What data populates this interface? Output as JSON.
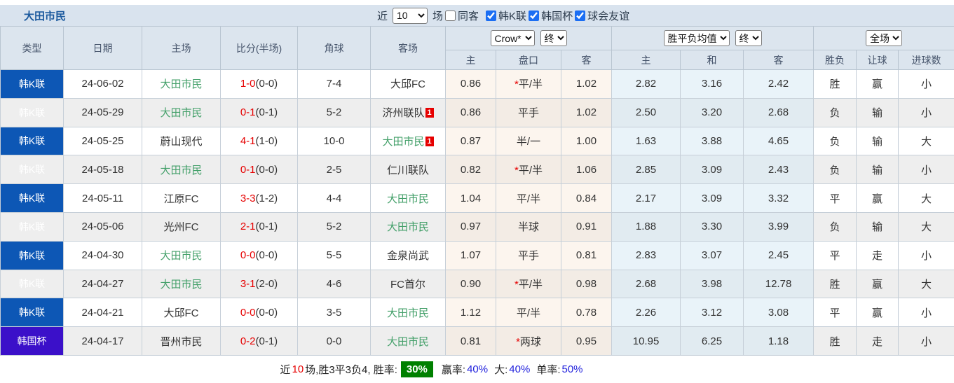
{
  "titlebar": {
    "title": "大田市民",
    "filters": {
      "recent_label": "近",
      "count_value": "10",
      "games_label": "场",
      "same_opponent": {
        "label": "同客",
        "checked": false
      },
      "leagues": [
        {
          "label": "韩K联",
          "checked": true
        },
        {
          "label": "韩国杯",
          "checked": true
        },
        {
          "label": "球会友谊",
          "checked": true
        }
      ]
    }
  },
  "table": {
    "header": {
      "main_columns": [
        "类型",
        "日期",
        "主场",
        "比分(半场)",
        "角球",
        "客场"
      ],
      "odds_group": {
        "company": "Crow*",
        "time": "终"
      },
      "avg_group": {
        "name": "胜平负均值",
        "time": "终"
      },
      "scope_group": {
        "scope": "全场"
      },
      "sub_columns": [
        "主",
        "盘口",
        "客",
        "主",
        "和",
        "客",
        "胜负",
        "让球",
        "进球数"
      ]
    },
    "rows": [
      {
        "type": "韩K联",
        "type_style": "league",
        "date": "24-06-02",
        "home": "大田市民",
        "home_self": true,
        "home_card": "",
        "score_ft": "1-0",
        "score_ht": "(0-0)",
        "corner": "7-4",
        "away": "大邱FC",
        "away_self": false,
        "away_card": "",
        "odds": {
          "home": "0.86",
          "handicap": "平/半",
          "star": true,
          "away": "1.02"
        },
        "avg": {
          "home": "2.82",
          "draw": "3.16",
          "away": "2.42"
        },
        "result": {
          "text": "胜",
          "color": "red"
        },
        "handicap_result": {
          "text": "赢",
          "color": "pink"
        },
        "goals": {
          "text": "小",
          "color": "green"
        }
      },
      {
        "type": "韩K联",
        "type_style": "league",
        "date": "24-05-29",
        "home": "大田市民",
        "home_self": true,
        "home_card": "",
        "score_ft": "0-1",
        "score_ht": "(0-1)",
        "corner": "5-2",
        "away": "济州联队",
        "away_self": false,
        "away_card": "1",
        "odds": {
          "home": "0.86",
          "handicap": "平手",
          "star": false,
          "away": "1.02"
        },
        "avg": {
          "home": "2.50",
          "draw": "3.20",
          "away": "2.68"
        },
        "result": {
          "text": "负",
          "color": "green"
        },
        "handicap_result": {
          "text": "输",
          "color": "green"
        },
        "goals": {
          "text": "小",
          "color": "green"
        }
      },
      {
        "type": "韩K联",
        "type_style": "league",
        "date": "24-05-25",
        "home": "蔚山现代",
        "home_self": false,
        "home_card": "",
        "score_ft": "4-1",
        "score_ht": "(1-0)",
        "corner": "10-0",
        "away": "大田市民",
        "away_self": true,
        "away_card": "1",
        "odds": {
          "home": "0.87",
          "handicap": "半/一",
          "star": false,
          "away": "1.00"
        },
        "avg": {
          "home": "1.63",
          "draw": "3.88",
          "away": "4.65"
        },
        "result": {
          "text": "负",
          "color": "green"
        },
        "handicap_result": {
          "text": "输",
          "color": "green"
        },
        "goals": {
          "text": "大",
          "color": "red"
        }
      },
      {
        "type": "韩K联",
        "type_style": "league",
        "date": "24-05-18",
        "home": "大田市民",
        "home_self": true,
        "home_card": "",
        "score_ft": "0-1",
        "score_ht": "(0-0)",
        "corner": "2-5",
        "away": "仁川联队",
        "away_self": false,
        "away_card": "",
        "odds": {
          "home": "0.82",
          "handicap": "平/半",
          "star": true,
          "away": "1.06"
        },
        "avg": {
          "home": "2.85",
          "draw": "3.09",
          "away": "2.43"
        },
        "result": {
          "text": "负",
          "color": "green"
        },
        "handicap_result": {
          "text": "输",
          "color": "green"
        },
        "goals": {
          "text": "小",
          "color": "green"
        }
      },
      {
        "type": "韩K联",
        "type_style": "league",
        "date": "24-05-11",
        "home": "江原FC",
        "home_self": false,
        "home_card": "",
        "score_ft": "3-3",
        "score_ht": "(1-2)",
        "corner": "4-4",
        "away": "大田市民",
        "away_self": true,
        "away_card": "",
        "odds": {
          "home": "1.04",
          "handicap": "平/半",
          "star": false,
          "away": "0.84"
        },
        "avg": {
          "home": "2.17",
          "draw": "3.09",
          "away": "3.32"
        },
        "result": {
          "text": "平",
          "color": "blue"
        },
        "handicap_result": {
          "text": "赢",
          "color": "pink"
        },
        "goals": {
          "text": "大",
          "color": "red"
        }
      },
      {
        "type": "韩K联",
        "type_style": "league",
        "date": "24-05-06",
        "home": "光州FC",
        "home_self": false,
        "home_card": "",
        "score_ft": "2-1",
        "score_ht": "(0-1)",
        "corner": "5-2",
        "away": "大田市民",
        "away_self": true,
        "away_card": "",
        "odds": {
          "home": "0.97",
          "handicap": "半球",
          "star": false,
          "away": "0.91"
        },
        "avg": {
          "home": "1.88",
          "draw": "3.30",
          "away": "3.99"
        },
        "result": {
          "text": "负",
          "color": "green"
        },
        "handicap_result": {
          "text": "输",
          "color": "green"
        },
        "goals": {
          "text": "大",
          "color": "red"
        }
      },
      {
        "type": "韩K联",
        "type_style": "league",
        "date": "24-04-30",
        "home": "大田市民",
        "home_self": true,
        "home_card": "",
        "score_ft": "0-0",
        "score_ht": "(0-0)",
        "corner": "5-5",
        "away": "金泉尚武",
        "away_self": false,
        "away_card": "",
        "odds": {
          "home": "1.07",
          "handicap": "平手",
          "star": false,
          "away": "0.81"
        },
        "avg": {
          "home": "2.83",
          "draw": "3.07",
          "away": "2.45"
        },
        "result": {
          "text": "平",
          "color": "blue"
        },
        "handicap_result": {
          "text": "走",
          "color": "blue"
        },
        "goals": {
          "text": "小",
          "color": "green"
        }
      },
      {
        "type": "韩K联",
        "type_style": "league",
        "date": "24-04-27",
        "home": "大田市民",
        "home_self": true,
        "home_card": "",
        "score_ft": "3-1",
        "score_ht": "(2-0)",
        "corner": "4-6",
        "away": "FC首尔",
        "away_self": false,
        "away_card": "",
        "odds": {
          "home": "0.90",
          "handicap": "平/半",
          "star": true,
          "away": "0.98"
        },
        "avg": {
          "home": "2.68",
          "draw": "3.98",
          "away": "12.78"
        },
        "result": {
          "text": "胜",
          "color": "red"
        },
        "handicap_result": {
          "text": "赢",
          "color": "pink"
        },
        "goals": {
          "text": "大",
          "color": "red"
        }
      },
      {
        "type": "韩K联",
        "type_style": "league",
        "date": "24-04-21",
        "home": "大邱FC",
        "home_self": false,
        "home_card": "",
        "score_ft": "0-0",
        "score_ht": "(0-0)",
        "corner": "3-5",
        "away": "大田市民",
        "away_self": true,
        "away_card": "",
        "odds": {
          "home": "1.12",
          "handicap": "平/半",
          "star": false,
          "away": "0.78"
        },
        "avg": {
          "home": "2.26",
          "draw": "3.12",
          "away": "3.08"
        },
        "result": {
          "text": "平",
          "color": "blue"
        },
        "handicap_result": {
          "text": "赢",
          "color": "pink"
        },
        "goals": {
          "text": "小",
          "color": "green"
        }
      },
      {
        "type": "韩国杯",
        "type_style": "cup",
        "date": "24-04-17",
        "home": "晋州市民",
        "home_self": false,
        "home_card": "",
        "score_ft": "0-2",
        "score_ht": "(0-1)",
        "corner": "0-0",
        "away": "大田市民",
        "away_self": true,
        "away_card": "",
        "odds": {
          "home": "0.81",
          "handicap": "两球",
          "star": true,
          "away": "0.95"
        },
        "avg": {
          "home": "10.95",
          "draw": "6.25",
          "away": "1.18"
        },
        "result": {
          "text": "胜",
          "color": "red"
        },
        "handicap_result": {
          "text": "走",
          "color": "blue"
        },
        "goals": {
          "text": "小",
          "color": "green"
        }
      }
    ]
  },
  "footer": {
    "prefix": "近",
    "count": "10",
    "stats": "场,胜3平3负4, 胜率:",
    "win_rate": "30%",
    "handicap_label": "赢率:",
    "handicap_rate": "40%",
    "big_label": "大:",
    "big_rate": "40%",
    "single_label": "单率:",
    "single_rate": "50%"
  },
  "colors": {
    "league_badge": "#0d57b5",
    "cup_badge": "#3b10c9",
    "self_team_green": "#44a06a",
    "score_red": "#e60000",
    "win_red": "#e62222",
    "handicap_win_pink": "#ee3366",
    "lose_green": "#6e9c5a",
    "draw_blue": "#4343ee",
    "avg_draw_blue": "#3b78ad",
    "win_rate_badge_bg": "#008000",
    "header_bg": "#dce5ee",
    "titlebar_bg": "#d9e3ee",
    "odds_col_bg": "#fcf5ee",
    "avg_col_bg": "#e9f3f9"
  }
}
